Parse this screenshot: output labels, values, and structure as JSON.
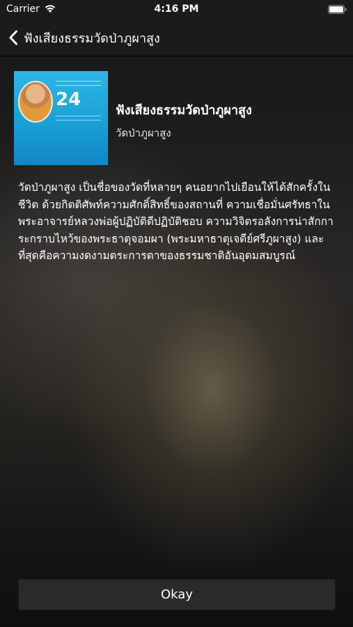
{
  "status_bar": {
    "carrier": "Carrier",
    "time": "4:16 PM",
    "wifi_icon": "wifi-icon",
    "battery_icon": "battery-icon"
  },
  "nav": {
    "back_icon": "chevron-left-icon",
    "title": "ฟังเสียงธรรมวัดป่าภูผาสูง"
  },
  "app": {
    "icon_number": "24",
    "name": "ฟังเสียงธรรมวัดป่าภูผาสูง",
    "author": "วัดป่าภูผาสูง",
    "description": "วัดป่าภูผาสูง เป็นชื่อของวัดที่หลายๆ คนอยากไปเยือนให้ได้สักครั้งในชีวิต ด้วยกิตติศัพท์ความศักดิ์สิทธิ์ของสถานที่ ความเชื่อมั่นศรัทธาในพระอาจารย์หลวงพ่อผู้ปฏิบัติดีปฏิบัติชอบ ความวิจิตรอลังการน่าสักการะกราบไหว้ของพระธาตุจอมผา (พระมหาธาตุเจดีย์ศรีภูผาสูง) และที่สุดคือความงดงามตระการตาของธรรมชาติอันอุดมสมบูรณ์"
  },
  "actions": {
    "okay_label": "Okay"
  },
  "colors": {
    "bar_background": "#1b1b1c",
    "button_background": "#2a2a2b",
    "icon_blue": "#1aa0d6"
  }
}
